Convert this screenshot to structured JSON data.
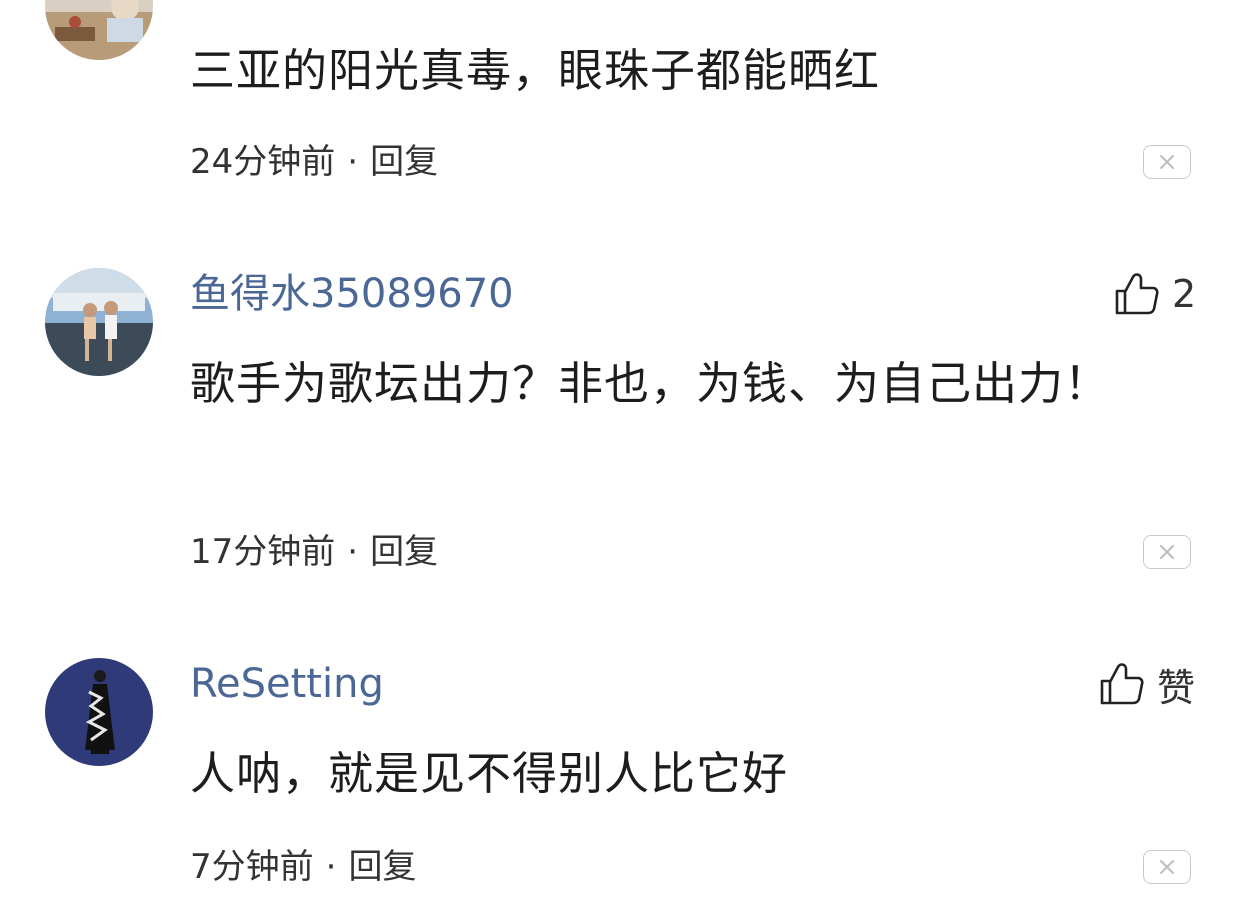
{
  "comments": [
    {
      "username": "",
      "text": "三亚的阳光真毒，眼珠子都能晒红",
      "time": "24分钟前",
      "separator": "·",
      "reply": "回复",
      "like": null
    },
    {
      "username": "鱼得水35089670",
      "text": "歌手为歌坛出力？非也，为钱、为自己出力！",
      "time": "17分钟前",
      "separator": "·",
      "reply": "回复",
      "like": "2"
    },
    {
      "username": "ReSetting",
      "text": "人呐，就是见不得别人比它好",
      "time": "7分钟前",
      "separator": "·",
      "reply": "回复",
      "like": "赞"
    }
  ],
  "icons": {
    "like": "thumbs-up-icon",
    "dismiss": "close-icon"
  },
  "colors": {
    "username": "#4a6796",
    "text": "#1d1d1d",
    "meta": "#333333",
    "border": "#c9c9c9"
  }
}
